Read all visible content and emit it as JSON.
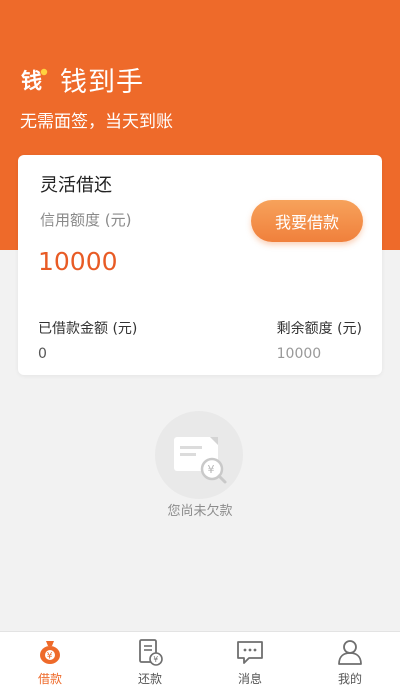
{
  "header": {
    "app_name": "钱到手",
    "logo_glyph": "钱",
    "tagline": "无需面签，当天到账",
    "bg_color": "#ee6a2a"
  },
  "card": {
    "title": "灵活借还",
    "limit_label": "信用额度 (元)",
    "limit_value": "10000",
    "borrow_button": "我要借款",
    "borrowed_label": "已借款金额 (元)",
    "borrowed_value": "0",
    "remaining_label": "剩余额度 (元)",
    "remaining_value": "10000"
  },
  "empty_state": {
    "icon": "bill-yen-search-icon",
    "message": "您尚未欠款"
  },
  "tabbar": {
    "active": "borrow",
    "accent": "#ee6a2a",
    "items": [
      {
        "key": "borrow",
        "label": "借款",
        "icon": "money-bag-icon"
      },
      {
        "key": "repay",
        "label": "还款",
        "icon": "repay-document-icon"
      },
      {
        "key": "messages",
        "label": "消息",
        "icon": "chat-bubble-icon"
      },
      {
        "key": "mine",
        "label": "我的",
        "icon": "user-icon"
      }
    ]
  }
}
